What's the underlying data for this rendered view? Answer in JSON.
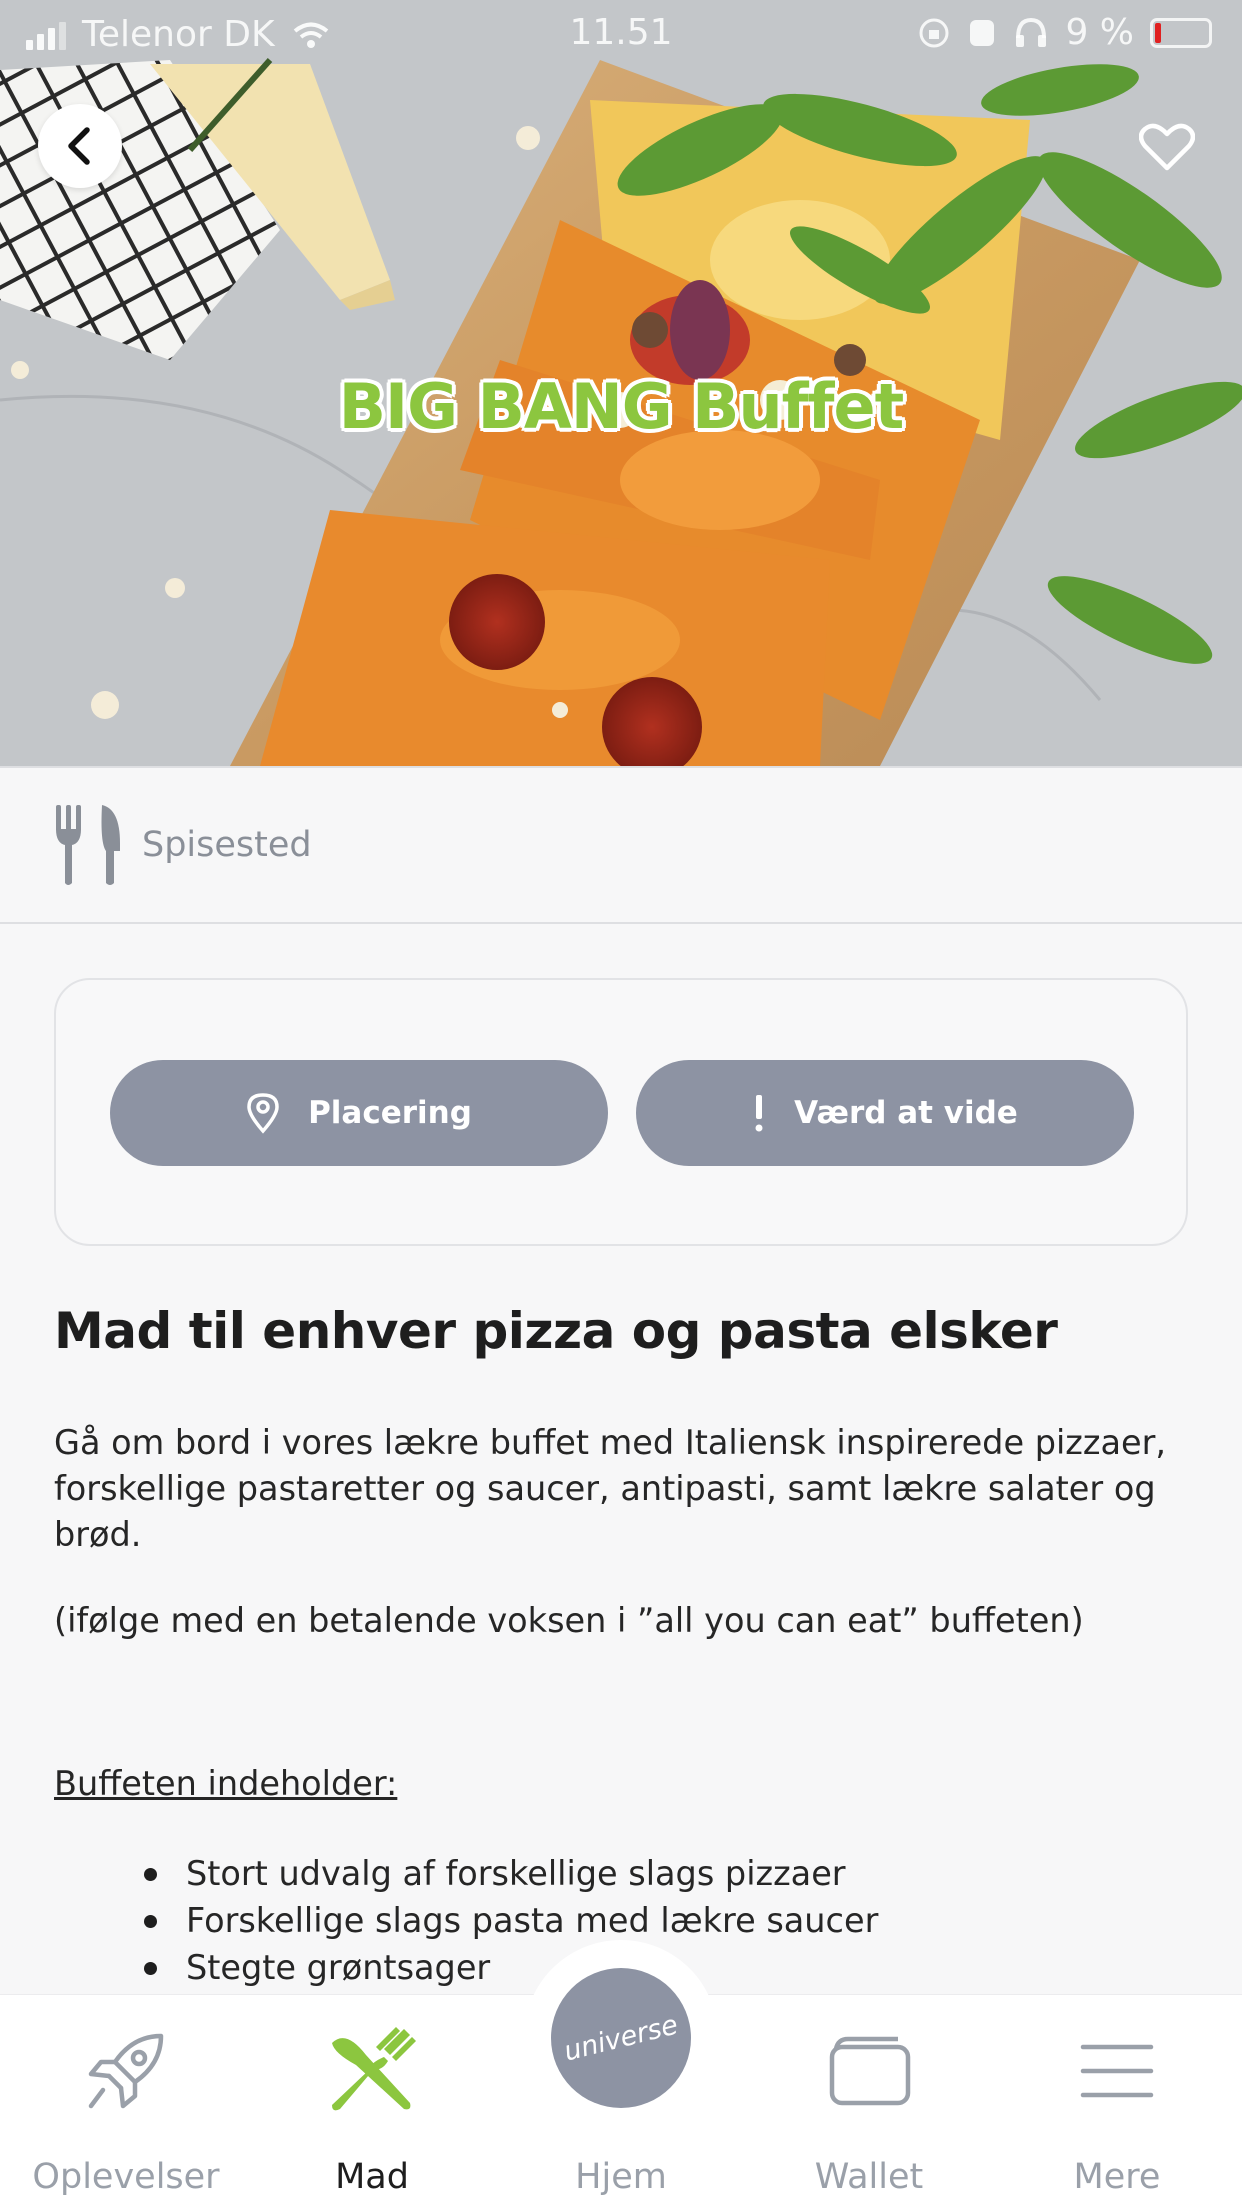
{
  "status_bar": {
    "carrier": "Telenor DK",
    "time": "11.51",
    "battery": "9 %"
  },
  "hero": {
    "title": "BIG BANG Buffet",
    "image_icon": "pizza-photo"
  },
  "category": {
    "icon": "cutlery-icon",
    "label": "Spisested"
  },
  "actions": {
    "location_label": "Placering",
    "location_icon": "location-pin-icon",
    "info_label": "Værd at vide",
    "info_icon": "exclamation-icon"
  },
  "content": {
    "headline": "Mad til enhver pizza og pasta elsker",
    "paragraph1": "Gå om bord i vores lækre buffet med Italiensk inspirerede pizzaer, forskellige pastaretter og saucer, antipasti, samt lækre salater og brød.",
    "paragraph2": "(ifølge med en betalende voksen i ”all you can eat” buffeten)",
    "subhead": "Buffeten indeholder:",
    "bullets": [
      "Stort udvalg af forskellige slags pizzaer",
      "Forskellige slags pasta med lækre saucer",
      "Stegte grøntsager"
    ]
  },
  "tabbar": {
    "tabs": [
      {
        "label": "Oplevelser",
        "icon": "rocket-icon"
      },
      {
        "label": "Mad",
        "icon": "fork-knife-icon"
      },
      {
        "label": "Hjem",
        "icon": "universe-logo"
      },
      {
        "label": "Wallet",
        "icon": "wallet-icon"
      },
      {
        "label": "Mere",
        "icon": "menu-icon"
      }
    ],
    "home_logo_text": "universe",
    "active_tab": "Mad"
  },
  "colors": {
    "accent_green": "#8cc63f",
    "pill_gray": "#8d93a3",
    "background": "#f7f7f8"
  }
}
